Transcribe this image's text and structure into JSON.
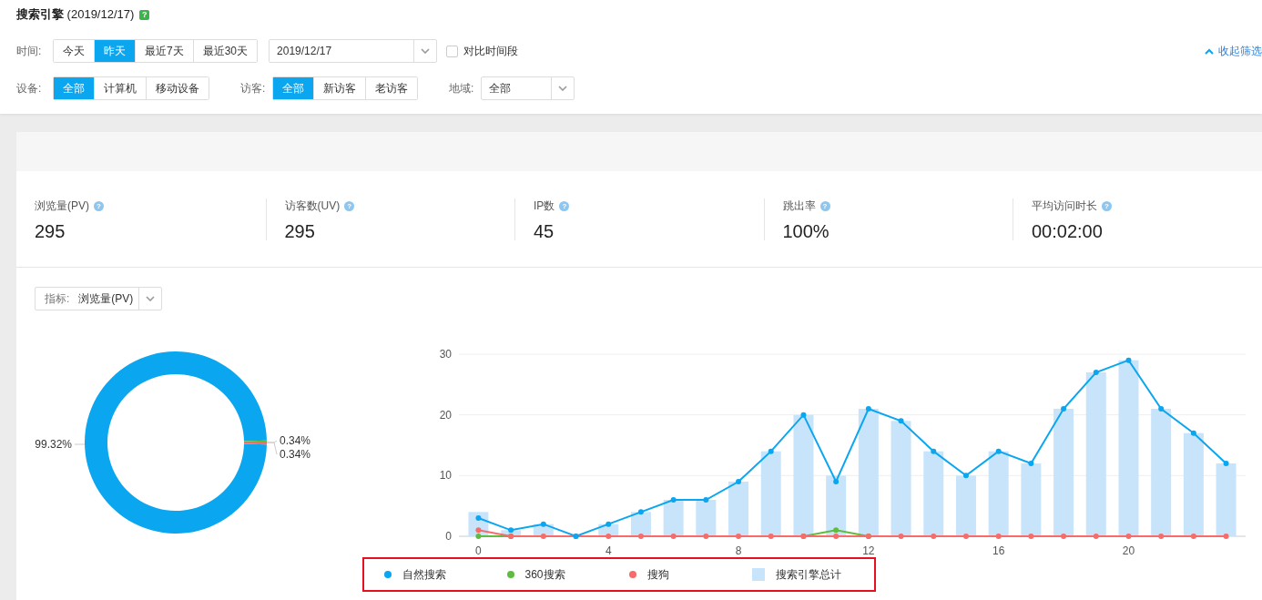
{
  "header": {
    "title": "**搜索引擎** (2019/12/17)",
    "help_badge": "?"
  },
  "filters": {
    "time": {
      "label": "时间:",
      "options": [
        {
          "label": "今天",
          "selected": false
        },
        {
          "label": "昨天",
          "selected": true
        },
        {
          "label": "最近7天",
          "selected": false
        },
        {
          "label": "最近30天",
          "selected": false
        }
      ],
      "date": {
        "value": "2019/12/17"
      },
      "compare": {
        "label": "对比时间段",
        "checked": false
      }
    },
    "collapse_link": "收起筛选",
    "device": {
      "label": "设备:",
      "options": [
        {
          "label": "全部",
          "selected": true
        },
        {
          "label": "计算机",
          "selected": false
        },
        {
          "label": "移动设备",
          "selected": false
        }
      ]
    },
    "visitor": {
      "label": "访客:",
      "options": [
        {
          "label": "全部",
          "selected": true
        },
        {
          "label": "新访客",
          "selected": false
        },
        {
          "label": "老访客",
          "selected": false
        }
      ]
    },
    "region": {
      "label": "地域:",
      "value": "全部"
    }
  },
  "stats": [
    {
      "label": "浏览量(PV)",
      "hint": "?",
      "value": "295"
    },
    {
      "label": "访客数(UV)",
      "hint": "?",
      "value": "295"
    },
    {
      "label": "IP数",
      "hint": "?",
      "value": "45"
    },
    {
      "label": "跳出率",
      "hint": "?",
      "value": "100%"
    },
    {
      "label": "平均访问时长",
      "hint": "?",
      "value": "00:02:00"
    }
  ],
  "metric_select": {
    "label": "指标:",
    "value": "浏览量(PV)"
  },
  "donut": {
    "chart_data": {
      "type": "donut",
      "values": [
        99.32,
        0.34,
        0.34
      ],
      "value_labels": [
        "99.32%",
        "0.34%",
        "0.34%"
      ]
    }
  },
  "trend": {
    "chart_data": {
      "type": "line",
      "x": [
        0,
        1,
        2,
        3,
        4,
        5,
        6,
        7,
        8,
        9,
        10,
        11,
        12,
        13,
        14,
        15,
        16,
        17,
        18,
        19,
        20,
        21,
        22,
        23
      ],
      "xlim": [
        -0.6,
        23.6
      ],
      "xticks": [
        0,
        4,
        8,
        12,
        16,
        20
      ],
      "yticks": [
        0,
        10,
        20,
        30
      ],
      "ylim": [
        0,
        30
      ],
      "series": [
        {
          "name": "自然搜索",
          "type": "line",
          "marker": true,
          "color": "#0aa6f0",
          "values": [
            3,
            1,
            2,
            0,
            2,
            4,
            6,
            6,
            9,
            14,
            20,
            9,
            21,
            19,
            14,
            10,
            14,
            12,
            21,
            27,
            29,
            21,
            17,
            12
          ]
        },
        {
          "name": "360搜索",
          "type": "line",
          "marker": true,
          "color": "#5ebd3e",
          "values": [
            0,
            0,
            null,
            null,
            null,
            null,
            null,
            null,
            null,
            null,
            0,
            1,
            0,
            null,
            null,
            null,
            null,
            null,
            null,
            null,
            null,
            null,
            null,
            null
          ]
        },
        {
          "name": "搜狗",
          "type": "line",
          "marker": true,
          "color": "#f76b6b",
          "values": [
            1,
            0,
            0,
            0,
            0,
            0,
            0,
            0,
            0,
            0,
            0,
            0,
            0,
            0,
            0,
            0,
            0,
            0,
            0,
            0,
            0,
            0,
            0,
            0
          ]
        },
        {
          "name": "搜索引擎总计",
          "type": "bar",
          "color": "#c8e4fb",
          "values": [
            4,
            1,
            2,
            0,
            2,
            4,
            6,
            6,
            9,
            14,
            20,
            10,
            21,
            19,
            14,
            10,
            14,
            12,
            21,
            27,
            29,
            21,
            17,
            12
          ]
        }
      ]
    }
  },
  "legend": {
    "highlighted": true
  }
}
